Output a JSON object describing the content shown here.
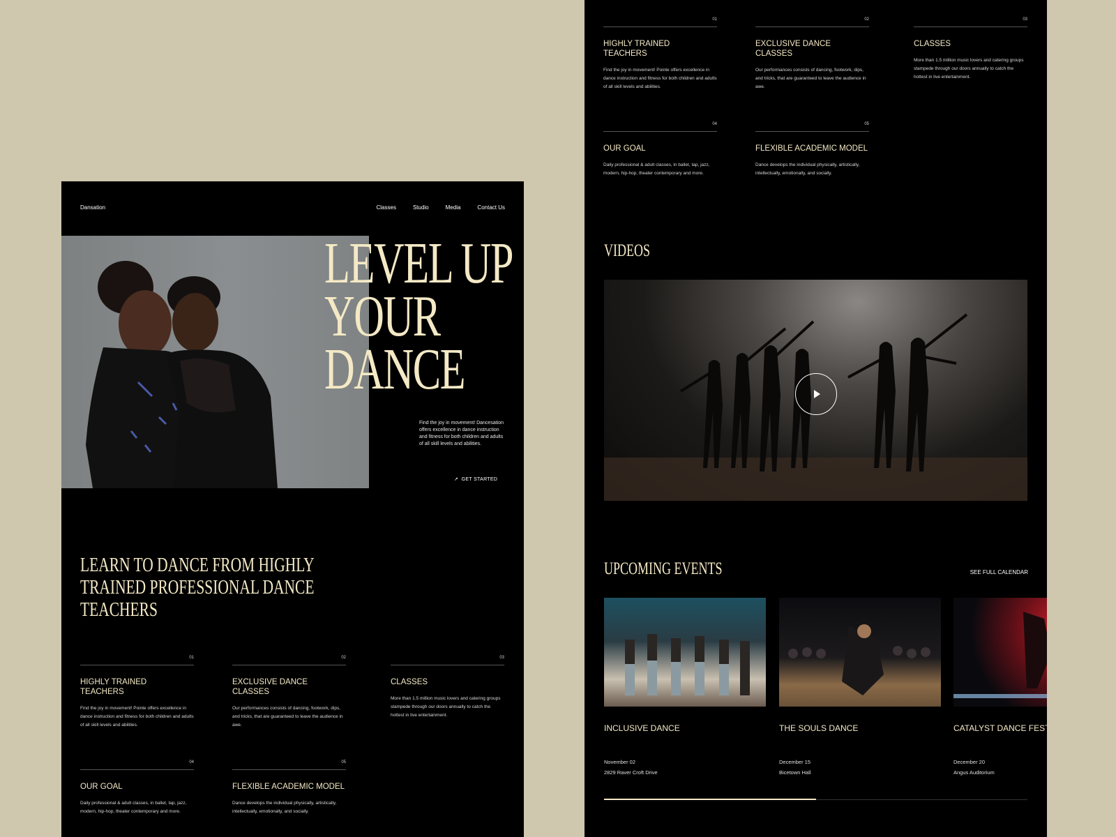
{
  "brand": "Dansation",
  "nav": {
    "classes": "Classes",
    "studio": "Studio",
    "media": "Media",
    "contact": "Contact Us"
  },
  "hero": {
    "title_lines": [
      "LEVEL UP",
      "YOUR",
      "DANCE"
    ],
    "description": "Find the joy in movement! Dancesation offers excellence in dance instruction and fitness for both children and adults of all skill levels and abilities.",
    "cta": "GET STARTED",
    "cta_icon": "arrow-up-right-icon"
  },
  "learn": {
    "lines": [
      "LEARN TO DANCE FROM HIGHLY",
      "TRAINED PROFESSIONAL DANCE",
      "TEACHERS"
    ]
  },
  "features": [
    {
      "num": "01",
      "title_lines": [
        "HIGHLY TRAINED",
        "TEACHERS"
      ],
      "desc": "Find the joy in movement! Pointe offers excellence in dance instruction and fitness for both children and adults of all skill levels and abilities."
    },
    {
      "num": "02",
      "title_lines": [
        "EXCLUSIVE DANCE",
        "CLASSES"
      ],
      "desc": "Our performances consists of dancing, footwork, dips, and tricks, that are guaranteed to leave the audience in awe."
    },
    {
      "num": "03",
      "title_lines": [
        "CLASSES",
        ""
      ],
      "desc": "More than 1.5 million music lovers and catering groups stampede through our doors annually to catch the hottest in live entertainment."
    },
    {
      "num": "04",
      "title_lines": [
        "OUR GOAL",
        ""
      ],
      "desc": "Daily professional & adult classes, in ballet, tap, jazz, modern, hip-hop, theater contemporary and more."
    },
    {
      "num": "05",
      "title_lines": [
        "FLEXIBLE ACADEMIC MODEL",
        ""
      ],
      "desc": "Dance develops the individual physically, artistically, intellectually, emotionally, and socially."
    }
  ],
  "videos": {
    "title": "VIDEOS",
    "play_icon": "play-icon"
  },
  "events": {
    "title": "UPCOMING EVENTS",
    "see_all": "SEE FULL CALENDAR",
    "items": [
      {
        "title": "INCLUSIVE DANCE",
        "date": "November 02",
        "location": "2829 Raver Croft Drive"
      },
      {
        "title": "THE SOULS DANCE",
        "date": "December 15",
        "location": "Bicetown Hall"
      },
      {
        "title": "CATALYST DANCE FESTIVAL",
        "date": "December 20",
        "location": "Angus Auditorium"
      }
    ],
    "progress": 0.5
  },
  "colors": {
    "background": "#cfc8ae",
    "accent": "#f4e9c5",
    "card": "#000000"
  }
}
